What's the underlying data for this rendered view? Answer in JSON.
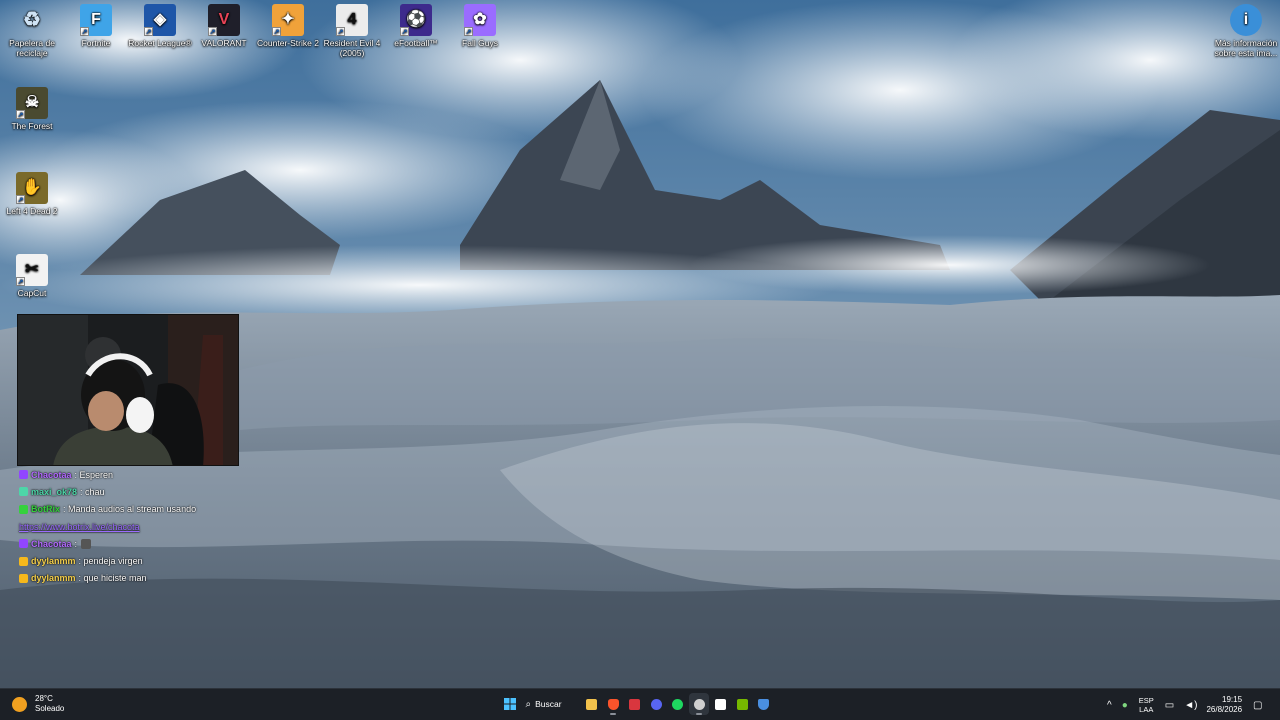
{
  "desktop": {
    "icons": [
      {
        "label": "Papelera de reciclaje",
        "icon": "recycle-bin-icon",
        "color": "#8fb6d8",
        "glyph": "♻"
      },
      {
        "label": "Fortnite",
        "icon": "fortnite-icon",
        "color": "#3fa4e8",
        "glyph": "F"
      },
      {
        "label": "Rocket League®",
        "icon": "rocket-league-icon",
        "color": "#1e56a8",
        "glyph": "◈"
      },
      {
        "label": "VALORANT",
        "icon": "valorant-icon",
        "color": "#e94457",
        "glyph": "V"
      },
      {
        "label": "Counter-Strike 2",
        "icon": "counter-strike-icon",
        "color": "#f0a23a",
        "glyph": "✦"
      },
      {
        "label": "Resident Evil 4 (2005)",
        "icon": "resident-evil-icon",
        "color": "#e8e8e8",
        "glyph": "4"
      },
      {
        "label": "eFootball™",
        "icon": "efootball-icon",
        "color": "#3d2a8c",
        "glyph": "⚽"
      },
      {
        "label": "Fall Guys",
        "icon": "fall-guys-icon",
        "color": "#9a6cff",
        "glyph": "✿"
      },
      {
        "label": "The Forest",
        "icon": "the-forest-icon",
        "color": "#5a5a3a",
        "glyph": "☠"
      },
      {
        "label": "Left 4 Dead 2",
        "icon": "left-4-dead-icon",
        "color": "#7a6a2a",
        "glyph": "✋"
      },
      {
        "label": "CapCut",
        "icon": "capcut-icon",
        "color": "#f2f2f2",
        "glyph": "✂"
      },
      {
        "label": "Más información sobre esta ima...",
        "icon": "spotlight-info-icon",
        "color": "#3a8fd8",
        "glyph": "i"
      }
    ]
  },
  "chat": {
    "messages": [
      {
        "user": "Chacotaa",
        "text": ": Esperen",
        "user_color": "#b36bff",
        "badge_color": "#9146ff"
      },
      {
        "user": "maxi_ok78",
        "text": ": chau",
        "user_color": "#4dd6a8",
        "badge_color": "#4dd6a8"
      },
      {
        "user": "BotRix",
        "text": ": Manda audios al stream usando",
        "user_color": "#35d13d",
        "badge_color": "#35d13d"
      },
      {
        "user": "",
        "text": "https://www.botrix.live/chacota",
        "user_color": "#9b6bff",
        "badge_color": ""
      },
      {
        "user": "Chacotaa",
        "text": ":",
        "user_color": "#b36bff",
        "badge_color": "#9146ff"
      },
      {
        "user": "dyylanmm",
        "text": ": pendeja virgen",
        "user_color": "#f5d04c",
        "badge_color": "#f5b81c"
      },
      {
        "user": "dyylanmm",
        "text": ": que hiciste man",
        "user_color": "#f5d04c",
        "badge_color": "#f5b81c"
      }
    ]
  },
  "taskbar": {
    "weather": {
      "temp": "28°C",
      "desc": "Soleado"
    },
    "search_label": "Buscar",
    "apps": [
      {
        "name": "file-explorer-icon",
        "color": "#f2c24c"
      },
      {
        "name": "brave-icon",
        "color": "#fb542b"
      },
      {
        "name": "calendar-icon",
        "color": "#d9363e"
      },
      {
        "name": "discord-icon",
        "color": "#5865f2"
      },
      {
        "name": "spotify-icon",
        "color": "#1ed760"
      },
      {
        "name": "obs-icon",
        "color": "#cfcfcf"
      },
      {
        "name": "capcut-icon",
        "color": "#ffffff"
      },
      {
        "name": "nvidia-icon",
        "color": "#76b900"
      },
      {
        "name": "defender-icon",
        "color": "#4a8fe0"
      }
    ],
    "tray": {
      "lang_top": "ESP",
      "lang_bottom": "LAA",
      "time": "19:15",
      "date": "26/8/2026"
    }
  }
}
